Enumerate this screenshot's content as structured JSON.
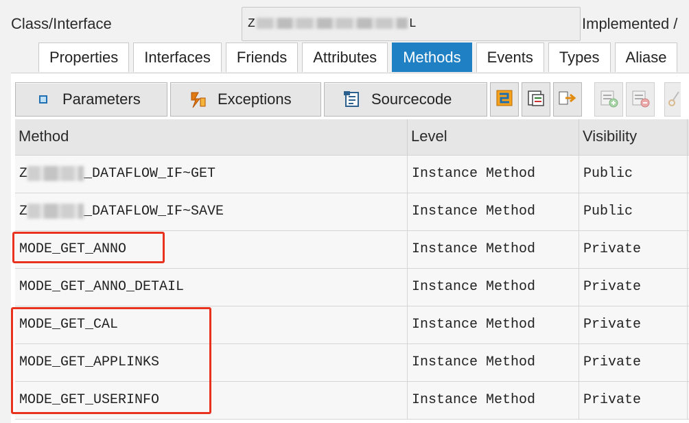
{
  "header": {
    "class_label": "Class/Interface",
    "class_value_prefix": "Z",
    "class_value_suffix": "L",
    "implemented_label": "Implemented /"
  },
  "tabs": [
    {
      "label": "Properties",
      "active": false
    },
    {
      "label": "Interfaces",
      "active": false
    },
    {
      "label": "Friends",
      "active": false
    },
    {
      "label": "Attributes",
      "active": false
    },
    {
      "label": "Methods",
      "active": true
    },
    {
      "label": "Events",
      "active": false
    },
    {
      "label": "Types",
      "active": false
    },
    {
      "label": "Aliase",
      "active": false
    }
  ],
  "toolbar": {
    "parameters_label": "Parameters",
    "exceptions_label": "Exceptions",
    "sourcecode_label": "Sourcecode"
  },
  "table": {
    "columns": [
      "Method",
      "Level",
      "Visibility"
    ],
    "rows": [
      {
        "method_prefix": "Z",
        "method": "_DATAFLOW_IF~GET",
        "level": "Instance Method",
        "visibility": "Public",
        "redacted": true
      },
      {
        "method_prefix": "Z",
        "method": "_DATAFLOW_IF~SAVE",
        "level": "Instance Method",
        "visibility": "Public",
        "redacted": true
      },
      {
        "method_prefix": "",
        "method": "MODE_GET_ANNO",
        "level": "Instance Method",
        "visibility": "Private",
        "redacted": false
      },
      {
        "method_prefix": "",
        "method": "MODE_GET_ANNO_DETAIL",
        "level": "Instance Method",
        "visibility": "Private",
        "redacted": false
      },
      {
        "method_prefix": "",
        "method": "MODE_GET_CAL",
        "level": "Instance Method",
        "visibility": "Private",
        "redacted": false
      },
      {
        "method_prefix": "",
        "method": "MODE_GET_APPLINKS",
        "level": "Instance Method",
        "visibility": "Private",
        "redacted": false
      },
      {
        "method_prefix": "",
        "method": "MODE_GET_USERINFO",
        "level": "Instance Method",
        "visibility": "Private",
        "redacted": false
      }
    ]
  },
  "colors": {
    "active_tab": "#1f80c4",
    "highlight": "#e8321e"
  }
}
